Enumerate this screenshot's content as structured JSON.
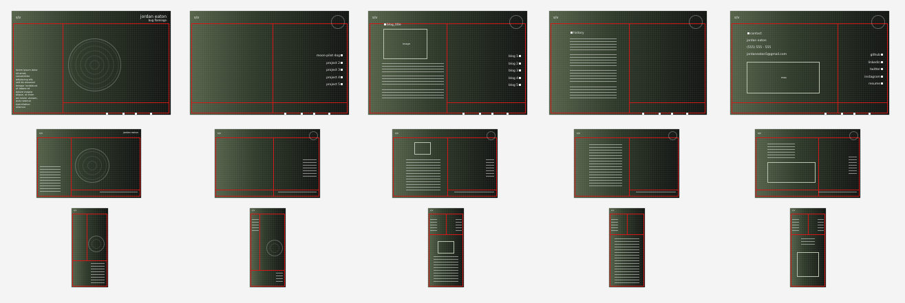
{
  "site": {
    "logo_text": "s/v",
    "owner_name": "jordan eaton",
    "owner_subtitle": "bug flamingo"
  },
  "nav_bottom": [
    "about",
    "projects",
    "blog",
    "history",
    "contact"
  ],
  "nav_bottom_alt": [
    "about",
    "projects",
    "blog",
    "history",
    "contact"
  ],
  "projects_page": {
    "items": [
      "moon-pilot dog",
      "project 2",
      "project 3",
      "project 4",
      "project 5"
    ]
  },
  "blog_page": {
    "post_title": "blog_title",
    "image_label": "image",
    "items": [
      "blog 1",
      "blog 2",
      "blog 3",
      "blog 4",
      "blog 5"
    ]
  },
  "history_page": {
    "heading": "history"
  },
  "contact_page": {
    "heading": "contact",
    "name": "jordan eaton",
    "phone": "(555) 555 - 555",
    "email": "jordaneaton5@gmail.com",
    "map_label": "map",
    "links": [
      "github",
      "linkedin",
      "twitter",
      "instagram",
      "resume"
    ]
  },
  "about_page": {
    "intro_lines": [
      "lorem ipsum dolor",
      "sit amet,",
      "consectetur",
      "adipiscing elit,",
      "sed do eiusmod",
      "tempor incididunt",
      "ut labore et",
      "dolore magna",
      "aliqua. ut enim",
      "ad minim veniam,",
      "quis nostrud",
      "exercitation",
      "ullamco"
    ]
  },
  "colors": {
    "frame_red": "#d21414",
    "bg_green": "#56634a",
    "bg_dark": "#121512",
    "page_bg": "#f4f4f4"
  }
}
